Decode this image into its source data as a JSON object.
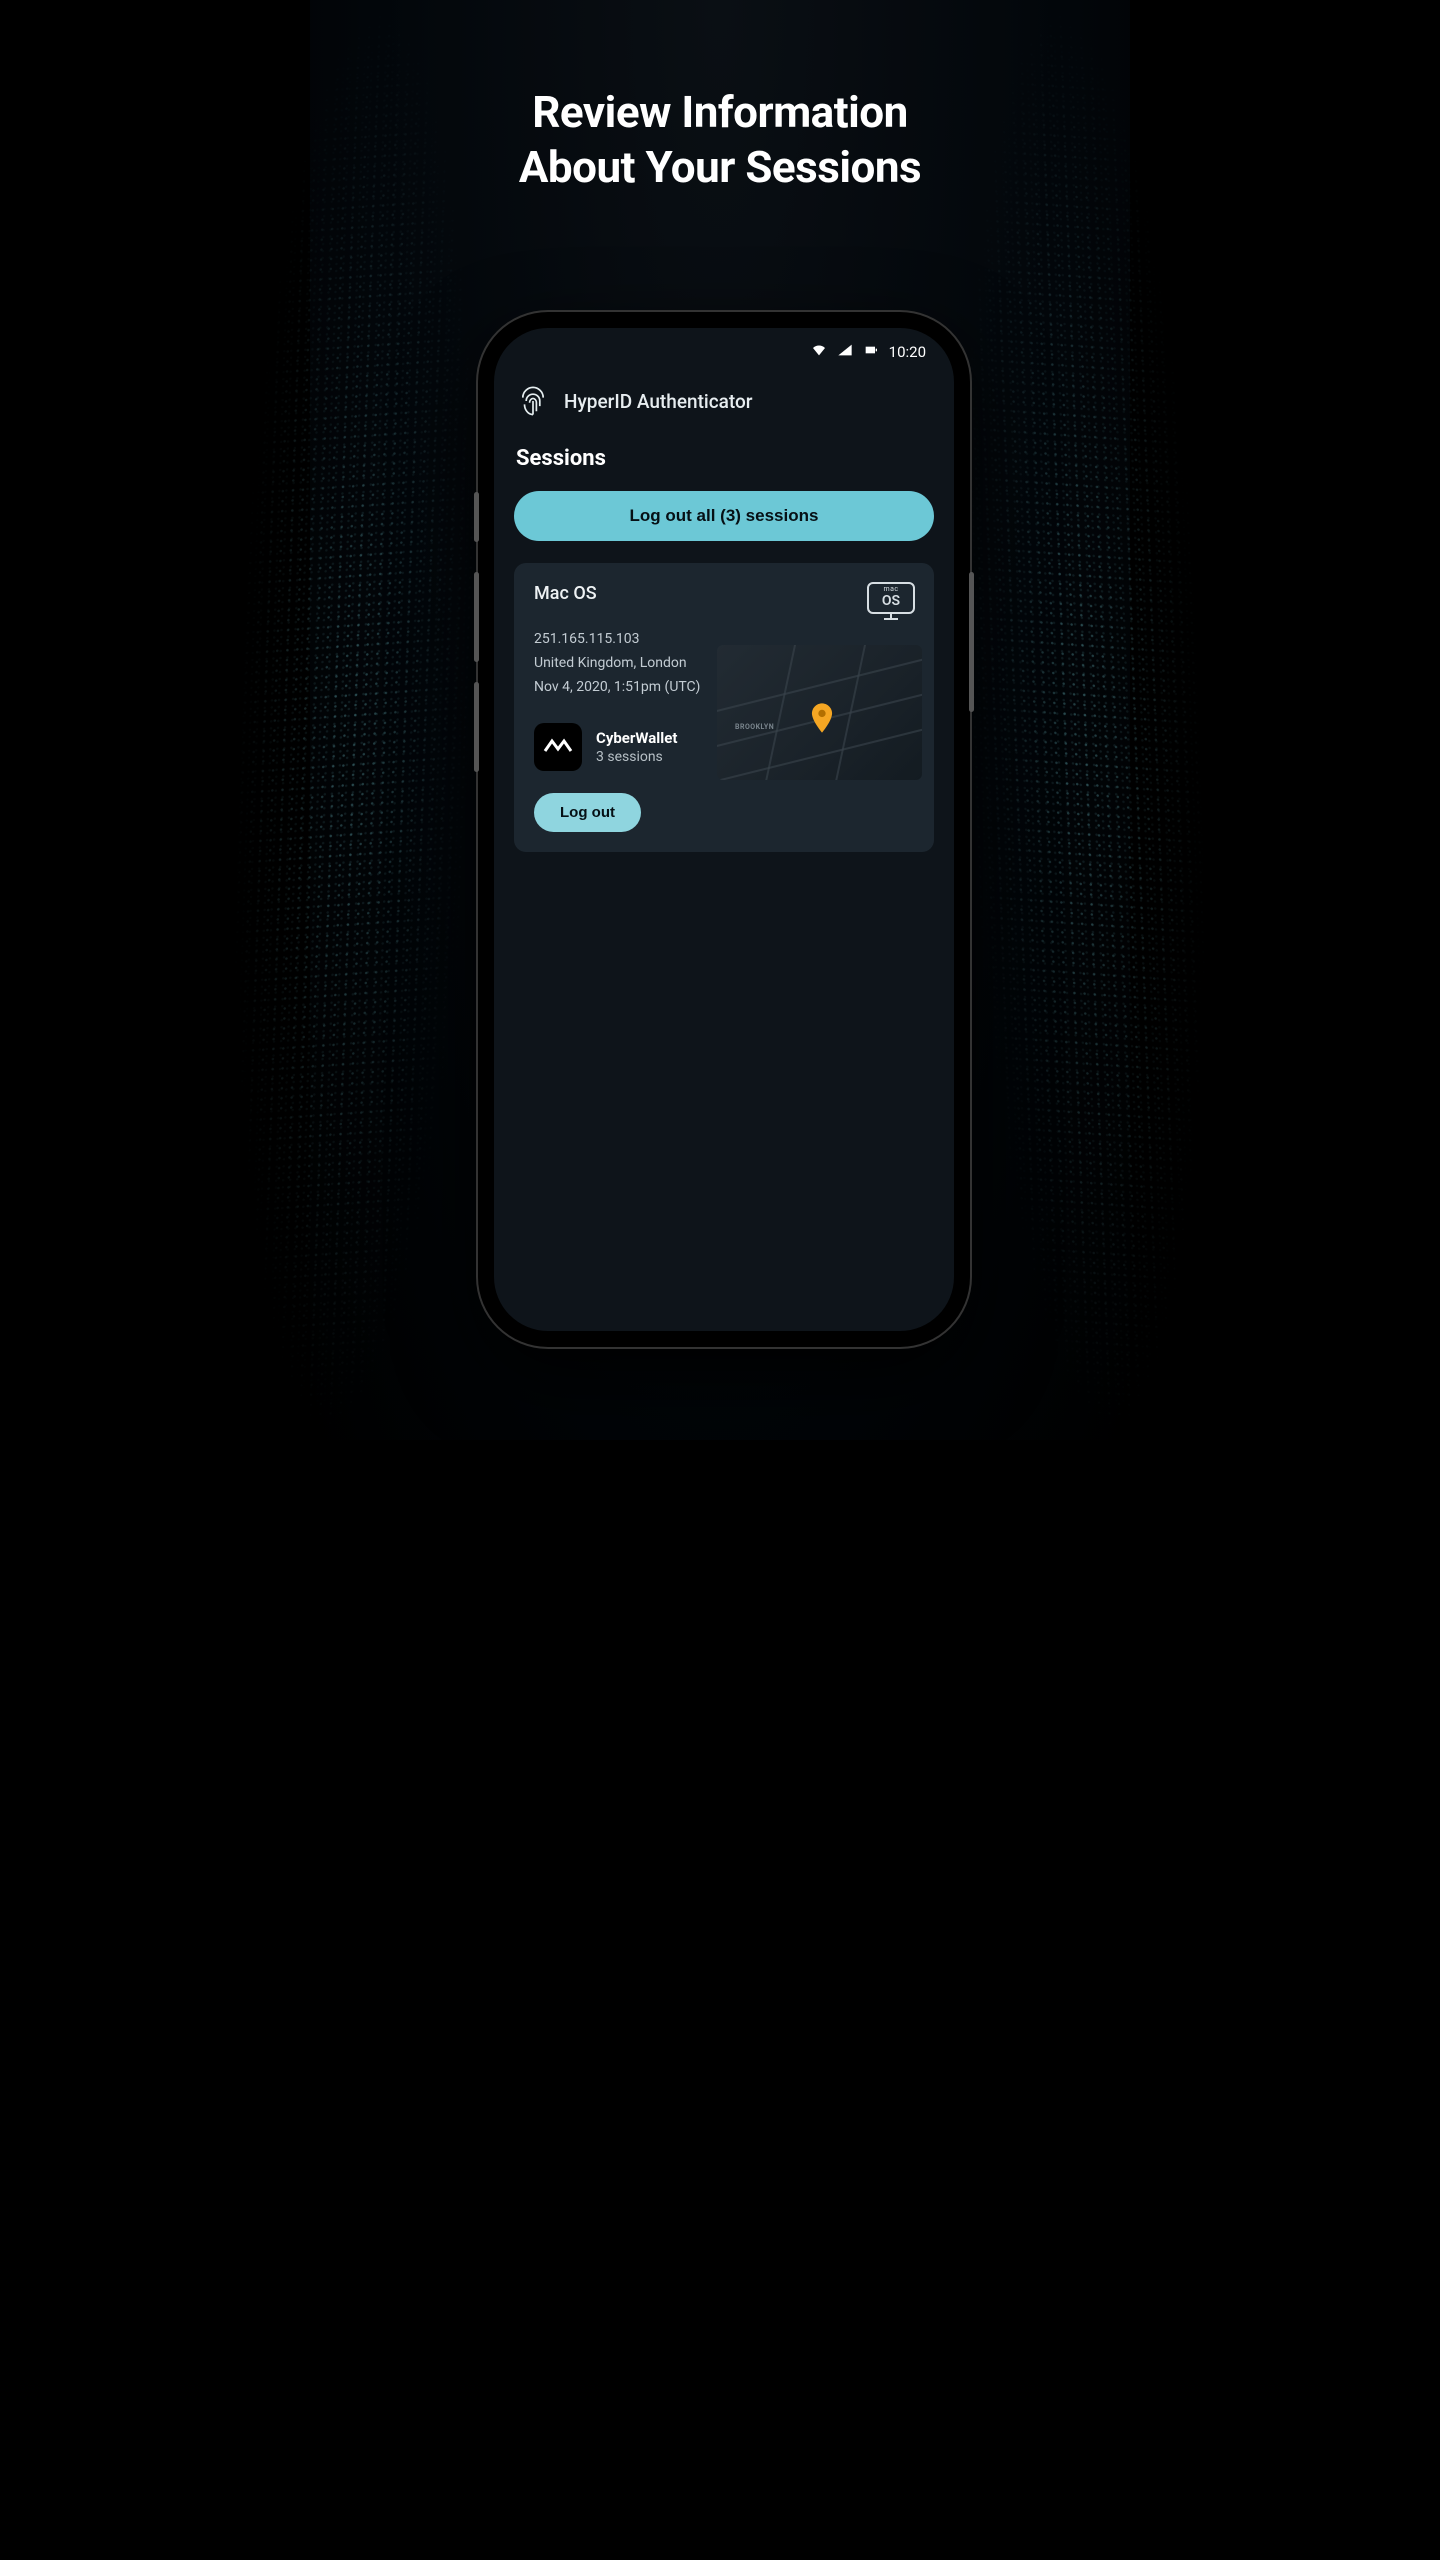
{
  "headline_l1": "Review Information",
  "headline_l2": "About Your Sessions",
  "status": {
    "time": "10:20"
  },
  "app": {
    "title": "HyperID Authenticator"
  },
  "section": {
    "title": "Sessions"
  },
  "actions": {
    "logout_all": "Log out all (3) sessions",
    "logout_one": "Log out"
  },
  "session": {
    "os": "Mac OS",
    "os_badge_small": "mac",
    "os_badge_big": "OS",
    "ip": "251.165.115.103",
    "location": "United Kingdom, London",
    "timestamp": "Nov 4, 2020, 1:51pm (UTC)",
    "wallet_name": "CyberWallet",
    "wallet_sessions": "3 sessions",
    "map_label": "BROOKLYN"
  }
}
